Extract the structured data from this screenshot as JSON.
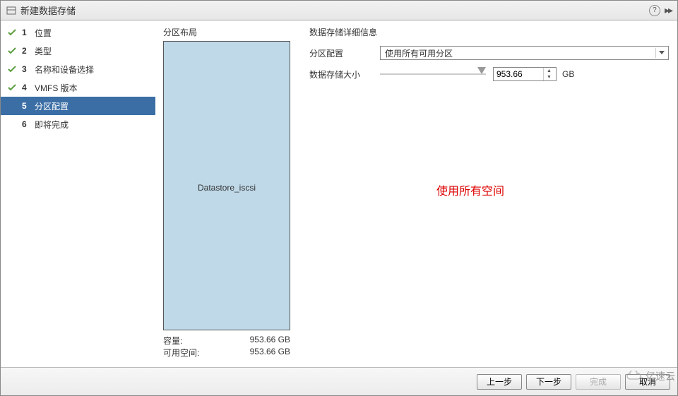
{
  "title": "新建数据存储",
  "steps": [
    {
      "num": "1",
      "label": "位置",
      "done": true,
      "active": false
    },
    {
      "num": "2",
      "label": "类型",
      "done": true,
      "active": false
    },
    {
      "num": "3",
      "label": "名称和设备选择",
      "done": true,
      "active": false
    },
    {
      "num": "4",
      "label": "VMFS 版本",
      "done": true,
      "active": false
    },
    {
      "num": "5",
      "label": "分区配置",
      "done": false,
      "active": true
    },
    {
      "num": "6",
      "label": "即将完成",
      "done": false,
      "active": false
    }
  ],
  "partition": {
    "section_label": "分区布局",
    "datastore_name": "Datastore_iscsi",
    "capacity_label": "容量:",
    "capacity_value": "953.66 GB",
    "free_label": "可用空间:",
    "free_value": "953.66 GB"
  },
  "details": {
    "section_label": "数据存储详细信息",
    "config_label": "分区配置",
    "config_value": "使用所有可用分区",
    "size_label": "数据存储大小",
    "size_value": "953.66",
    "size_unit": "GB"
  },
  "annotation": "使用所有空间",
  "footer": {
    "back": "上一步",
    "next": "下一步",
    "finish": "完成",
    "cancel": "取消"
  },
  "watermark": "亿速云"
}
